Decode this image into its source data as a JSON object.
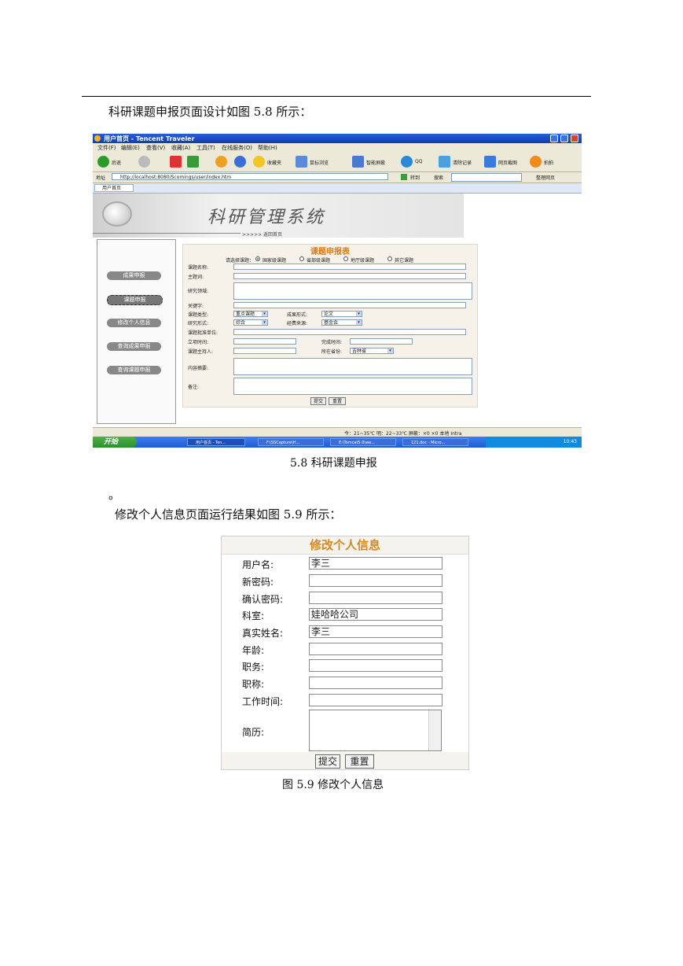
{
  "intro_text": "科研课题申报页面设计如图 5.8 所示：",
  "figure58": {
    "window_title": "用户首页 - Tencent Traveler",
    "menu": [
      "文件(F)",
      "编辑(E)",
      "查看(V)",
      "收藏(A)",
      "工具(T)",
      "在线服务(O)",
      "帮助(H)"
    ],
    "toolbar": {
      "back": "后退",
      "favorites": "收藏夹",
      "preview": "鼠标浏览",
      "smart_screen": "智能屏蔽",
      "qq": "QQ",
      "clear": "清除记录",
      "capture": "网页截图",
      "photo": "拍拍"
    },
    "address_label": "地址",
    "address_url": "http://localhost:8080/Scomings/user/index.htm",
    "go_label": "转到",
    "search_label": "搜索",
    "switch_label": "整理网页",
    "tab_label": "用户首页",
    "brand_title": "科研管理系统",
    "back_home": ">>>>>  返回首页",
    "nav": [
      "成果申报",
      "课题申报",
      "修改个人信息",
      "查询成果申报",
      "查询课题申报"
    ],
    "form": {
      "title": "课题申报表",
      "select_prompt": "请选择课题：",
      "radio_options": [
        "国家级课题",
        "省部级课题",
        "地厅级课题",
        "其它课题"
      ],
      "labels": {
        "name": "课题名称:",
        "subject": "主题词:",
        "field": "研究领域:",
        "keywords": "关键字:",
        "type": "课题类型:",
        "result_form": "成果形式:",
        "research_form": "研究形式:",
        "funding": "经费来源:",
        "approval_unit": "课题批准单位:",
        "start_time": "立项时间:",
        "finish_time": "完成时间:",
        "leader": "课题主持人:",
        "department": "所在省份:",
        "summary": "内容摘要:",
        "remarks": "备注:"
      },
      "selects": {
        "type": "重点课题",
        "result_form": "论文",
        "research_form": "综合",
        "funding": "基金会",
        "department": "吉林省"
      },
      "submit": "提交",
      "reset": "重置"
    },
    "status_text": "今：21~35℃  明：22~33℃  屏蔽：×0  ×0  本地 Intra",
    "taskbar": {
      "start": "开始",
      "tasks": [
        "用户首页 - Ten...",
        "F:\\SSCapture\\H...",
        "E:\\Tomcat5.0\\we...",
        "121.doc - Micro..."
      ],
      "clock": "10:43"
    }
  },
  "caption58": "5.8 科研课题申报",
  "stray_mark": "。",
  "intro_text2": "修改个人信息页面运行结果如图 5.9 所示：",
  "figure59": {
    "title": "修改个人信息",
    "fields": [
      {
        "label": "用户名:",
        "value": "李三"
      },
      {
        "label": "新密码:",
        "value": ""
      },
      {
        "label": "确认密码:",
        "value": ""
      },
      {
        "label": "科室:",
        "value": "娃哈哈公司"
      },
      {
        "label": "真实姓名:",
        "value": "李三"
      },
      {
        "label": "年龄:",
        "value": ""
      },
      {
        "label": "职务:",
        "value": ""
      },
      {
        "label": "职称:",
        "value": ""
      },
      {
        "label": "工作时间:",
        "value": ""
      }
    ],
    "resume_label": "简历:",
    "submit": "提交",
    "reset": "重置"
  },
  "caption59": "图 5.9 修改个人信息"
}
